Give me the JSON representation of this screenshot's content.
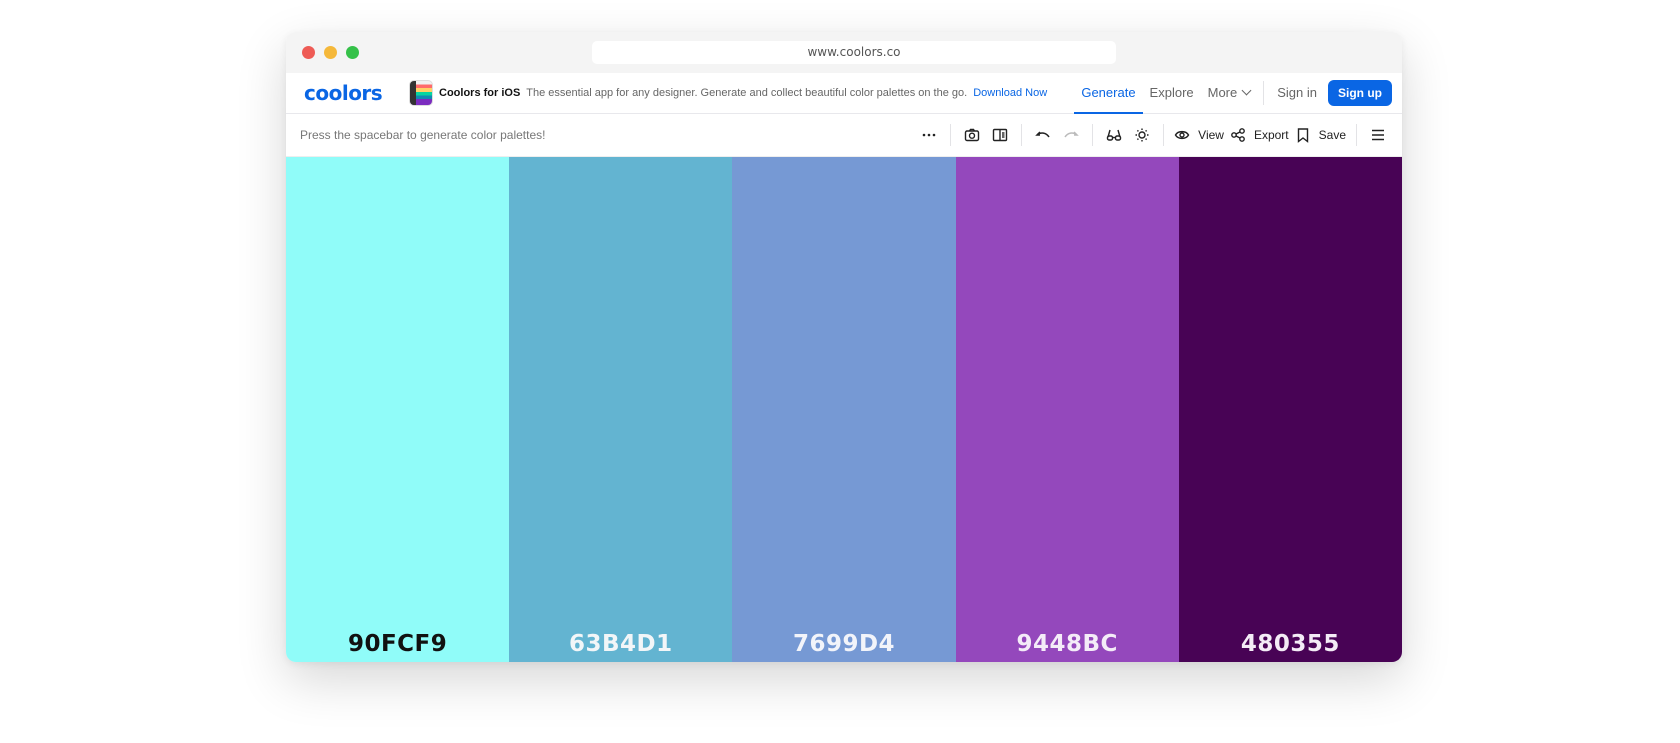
{
  "browser": {
    "url": "www.coolors.co"
  },
  "navbar": {
    "logo": "coolors",
    "promo": {
      "title": "Coolors for iOS",
      "text": "The essential app for any designer. Generate and collect beautiful color palettes on the go.",
      "link": "Download Now"
    },
    "links": [
      {
        "label": "Generate",
        "active": true
      },
      {
        "label": "Explore",
        "active": false
      },
      {
        "label": "More",
        "active": false
      }
    ],
    "sign_in": "Sign in",
    "sign_up": "Sign up",
    "accent_color": "#0A66E4"
  },
  "toolbar": {
    "hint": "Press the spacebar to generate color palettes!",
    "icons": [
      "more-horizontal-icon",
      "camera-icon",
      "panel-icon",
      "undo-icon",
      "redo-icon",
      "glasses-icon",
      "brightness-icon",
      "eye-icon",
      "share-icon",
      "bookmark-icon",
      "menu-icon"
    ],
    "view_label": "View",
    "export_label": "Export",
    "save_label": "Save"
  },
  "palette": [
    {
      "hex": "90FCF9",
      "color": "#90FCF9",
      "text_color": "#111111"
    },
    {
      "hex": "63B4D1",
      "color": "#63B4D1",
      "text_color": "#F2F6F8"
    },
    {
      "hex": "7699D4",
      "color": "#7699D4",
      "text_color": "#F2F4FA"
    },
    {
      "hex": "9448BC",
      "color": "#9448BC",
      "text_color": "#F4ECF8"
    },
    {
      "hex": "480355",
      "color": "#480355",
      "text_color": "#F4ECF6"
    }
  ]
}
